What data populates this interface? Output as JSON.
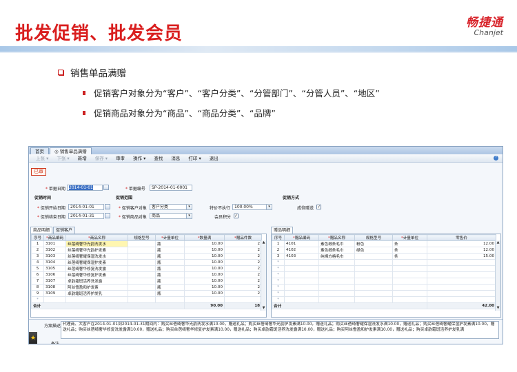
{
  "slide": {
    "title": "批发促销、批发会员",
    "logo_cn": "畅捷通",
    "logo_en": "Chanjet",
    "bullet_main": "销售单品满赠",
    "sub_bullets": [
      "促销客户对象分为“客户”、“客户分类”、“分管部门”、“分管人员”、“地区”",
      "促销商品对象分为“商品”、“商品分类”、“品牌”"
    ]
  },
  "app": {
    "tabs": [
      "首页",
      "◎ 销售单品满赠"
    ],
    "toolbar": [
      "上张 ▾",
      "下张 ▾",
      "新增",
      "保存 ▾",
      "审审",
      "操作 ▾",
      "查找",
      "消息",
      "打印 ▾",
      "退出"
    ],
    "status_stamp": "已审",
    "form": {
      "doc_date_label": "单据日期",
      "doc_date_value": "2014-01-01",
      "doc_no_label": "单据编号",
      "doc_no_value": "SP-2014-01-0001",
      "promo_time_section": "促销时间",
      "promo_scope_section": "促销范围",
      "promo_method_section": "促销方式",
      "start_label": "促销开始日期",
      "start_value": "2014-01-01",
      "end_label": "促销结束日期",
      "end_value": "2014-01-31",
      "cust_obj_label": "促销客户对象",
      "cust_obj_value": "客户分类",
      "goods_obj_label": "促销商品对象",
      "goods_obj_value": "商品",
      "special_price_label": "特价不执行",
      "special_price_value": "100.00%",
      "member_points_label": "会员积分",
      "gift_overlay_label": "成倍赠送"
    },
    "left_panel": {
      "tabs": [
        "商品明细",
        "促销客户"
      ],
      "headers": [
        "序号",
        "商品编码",
        "商品名称",
        "规格型号",
        "计量单位",
        "数量满",
        "赠品件数"
      ],
      "required_cols": [
        1,
        2,
        4,
        5,
        6
      ],
      "rows": [
        [
          "1",
          "3101",
          "丝蓓绮奢华光韵洗发水",
          "",
          "瓶",
          "10.00",
          "2"
        ],
        [
          "2",
          "3102",
          "丝蓓绮奢华光韵护发素",
          "",
          "瓶",
          "10.00",
          "2"
        ],
        [
          "3",
          "3103",
          "丝蓓绮奢耀保湿洗发水",
          "",
          "瓶",
          "10.00",
          "2"
        ],
        [
          "4",
          "3104",
          "丝蓓绮奢耀保湿护发素",
          "",
          "瓶",
          "10.00",
          "2"
        ],
        [
          "5",
          "3105",
          "丝蓓绮奢华修复洗发露",
          "",
          "瓶",
          "10.00",
          "2"
        ],
        [
          "6",
          "3106",
          "丝蓓绮奢华修复护发素",
          "",
          "瓶",
          "10.00",
          "2"
        ],
        [
          "7",
          "3107",
          "卓韵霜斑活养洗发露",
          "",
          "瓶",
          "10.00",
          "2"
        ],
        [
          "8",
          "3108",
          "阿丝雪盈和护发素",
          "",
          "瓶",
          "10.00",
          "2"
        ],
        [
          "9",
          "3109",
          "卓韵霜斑活养护发乳",
          "",
          "瓶",
          "10.00",
          "2"
        ]
      ],
      "total_label": "合计",
      "total_qty": "90.00",
      "total_gift": "18"
    },
    "right_panel": {
      "tabs": [
        "赠品明细"
      ],
      "headers": [
        "序号",
        "赠品编码",
        "赠品名称",
        "规格型号",
        "计量单位",
        "零售价"
      ],
      "required_cols": [
        1,
        2,
        4
      ],
      "rows": [
        [
          "1",
          "4101",
          "素色缎条毛巾",
          "粉色",
          "条",
          "12.00"
        ],
        [
          "2",
          "4102",
          "素色缎条毛巾",
          "绿色",
          "条",
          "12.00"
        ],
        [
          "3",
          "4103",
          "纯棉方格毛巾",
          "",
          "条",
          "15.00"
        ]
      ],
      "total_label": "合计",
      "total_price": "42.00"
    },
    "desc_label": "方案描述",
    "desc_text": "代理商、大客户在2014-01-01到2014-01-31期间内：购买丝蓓绮奢华光韵洗发水满10.00，赠送礼品；购买丝蓓绮奢华光韵护发素满10.00，赠送礼品；购买丝蓓绮奢耀保湿洗发水满10.00，赠送礼品；购买丝蓓绮奢耀保湿护发素满10.00，赠送礼品；购买丝蓓绮奢华修复洗发露满10.00，赠送礼品；购买丝蓓绮奢华修复护发素满10.00，赠送礼品；购买卓韵霜斑活养洗发露满10.00，赠送礼品；购买阿丝雪盈和护发素满10.00，赠送礼品；购买卓韵霜斑活养护发乳满",
    "remark_label": "备注"
  }
}
